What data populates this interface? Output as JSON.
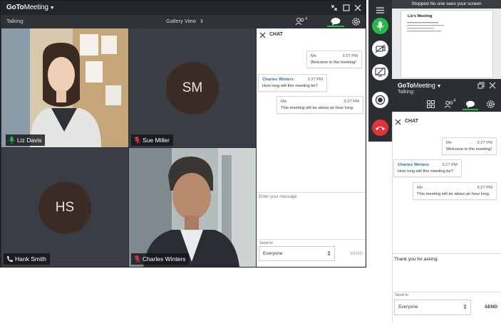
{
  "main_window": {
    "app_name_bold": "GoTo",
    "app_name_rest": "Meeting",
    "talking_label": "Talking:",
    "view_selector": "Gallery View",
    "participant_count": "4",
    "participants": [
      {
        "name": "Liz Davis",
        "initials": "",
        "mic": "on"
      },
      {
        "name": "Sue Miller",
        "initials": "SM",
        "mic": "muted"
      },
      {
        "name": "Hank Smith",
        "initials": "HS",
        "mic": "phone"
      },
      {
        "name": "Charles Winters",
        "initials": "",
        "mic": "muted"
      }
    ]
  },
  "chat": {
    "title": "CHAT",
    "messages": [
      {
        "from": "Me",
        "time": "3:27 PM",
        "text": "Welcome to the meeting!"
      },
      {
        "from": "Charles Winters",
        "time": "3:27 PM",
        "text": "How long will this meeting be?"
      },
      {
        "from": "Me",
        "time": "3:27 PM",
        "text": "This meeting will be about an hour long."
      }
    ],
    "input_placeholder": "Enter your message",
    "send_to_label": "Send to",
    "send_to_value": "Everyone",
    "send_label": "SEND"
  },
  "compact": {
    "status_text": "Stopped  No one sees your screen",
    "doc_title": "Liz's Meeting",
    "app_name_bold": "GoTo",
    "app_name_rest": "Meeting",
    "talking_label": "Talking:",
    "participant_count": "4",
    "chat_title": "CHAT",
    "messages": [
      {
        "from": "Me",
        "time": "3:27 PM",
        "text": "Welcome to the meeting!"
      },
      {
        "from": "Charles Winters",
        "time": "3:27 PM",
        "text": "How long will this meeting be?"
      },
      {
        "from": "Me",
        "time": "3:27 PM",
        "text": "This meeting will be about an hour long."
      }
    ],
    "draft_text": "Thank you for asking.",
    "send_to_label": "Send to",
    "send_to_value": "Everyone",
    "send_label": "SEND"
  },
  "colors": {
    "accent_green": "#27b84a",
    "danger_red": "#e0343a",
    "link_blue": "#2a6fb4",
    "muted_red": "#d9343b"
  }
}
